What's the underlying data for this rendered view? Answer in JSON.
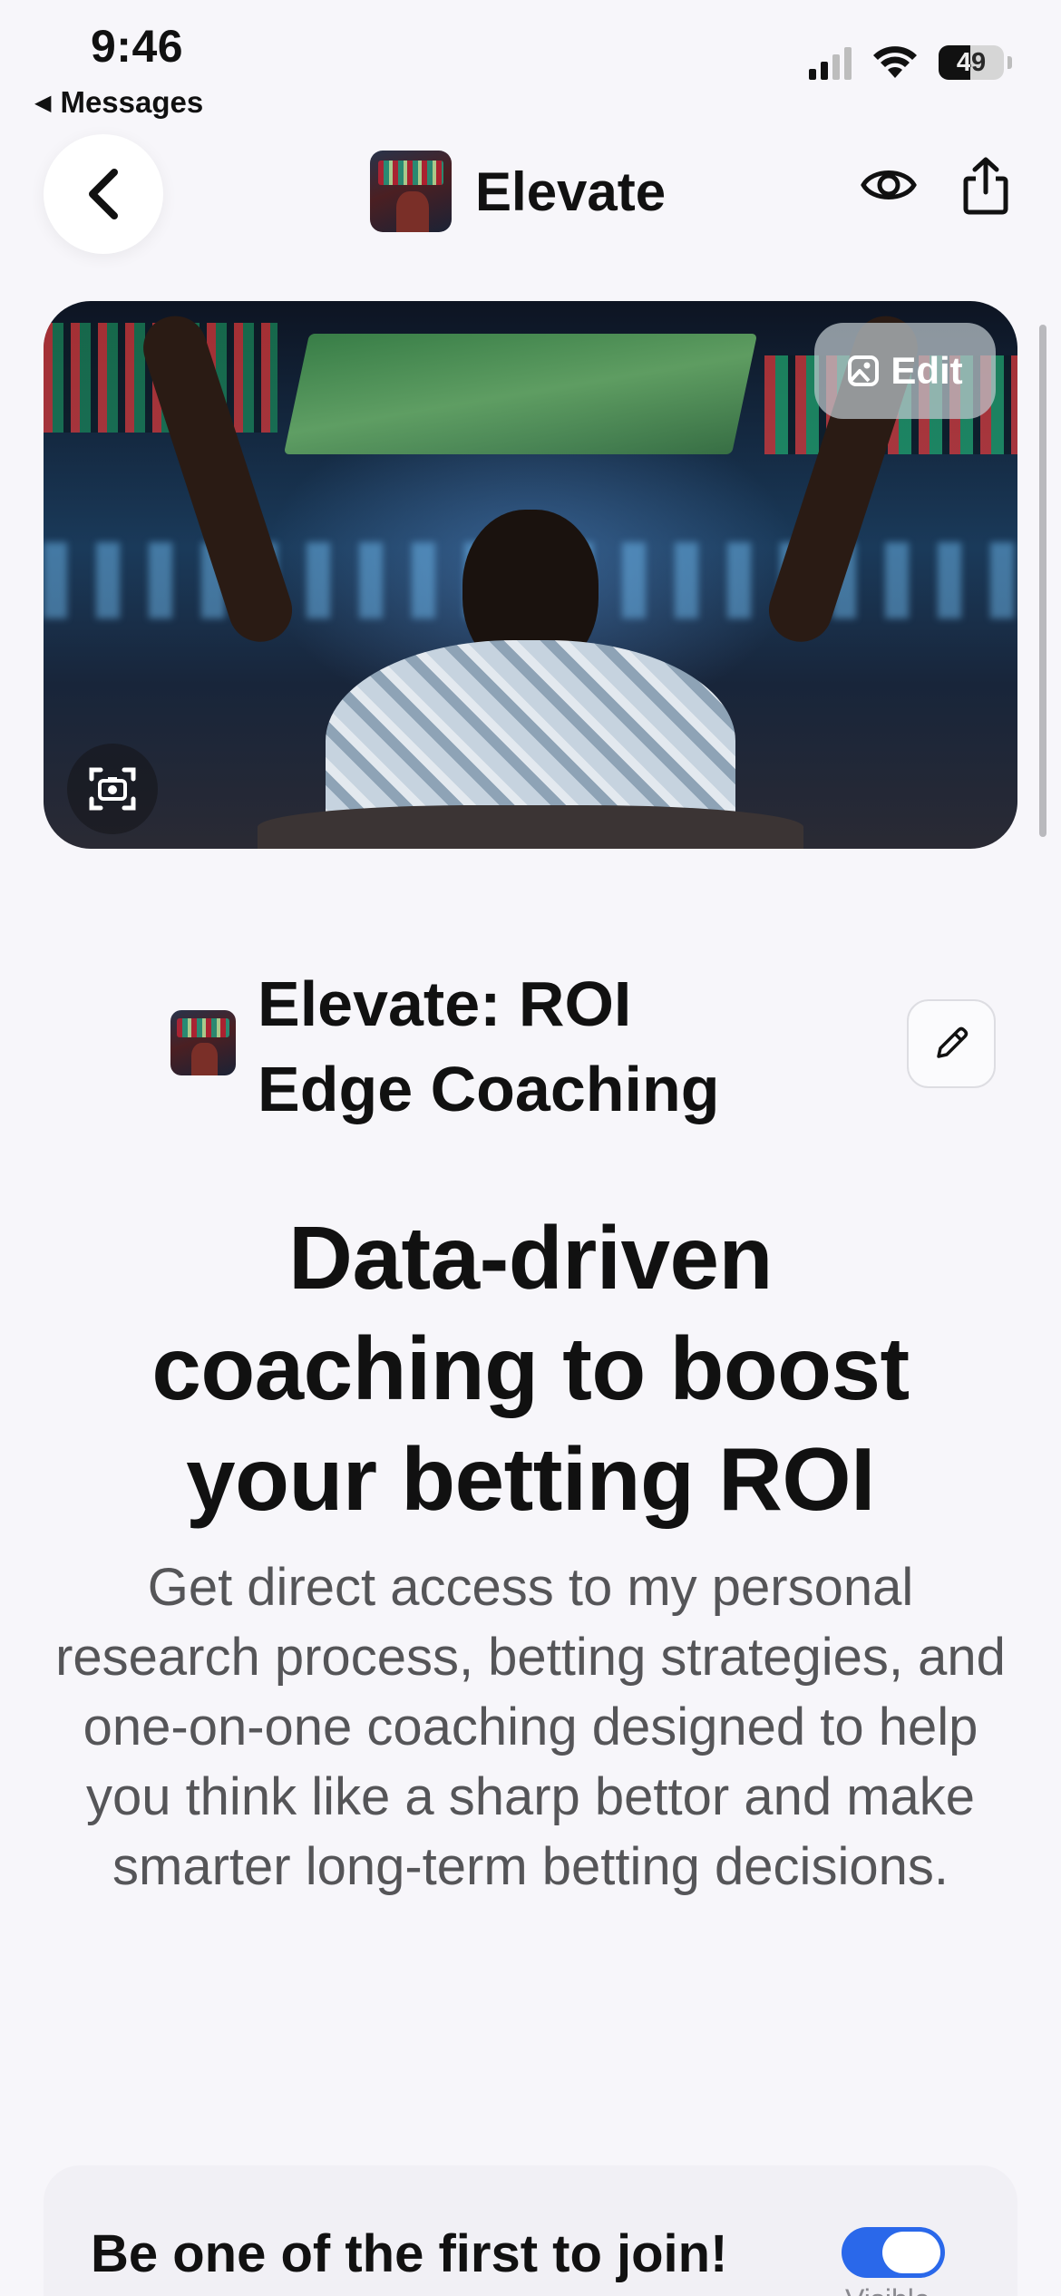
{
  "status_bar": {
    "time": "9:46",
    "back_app": "Messages",
    "battery": "49"
  },
  "nav": {
    "title": "Elevate",
    "icons": [
      "chevron-left-icon",
      "eye-icon",
      "share-icon"
    ]
  },
  "hero": {
    "edit_label": "Edit"
  },
  "product": {
    "title_line1": "Elevate: ROI",
    "title_line2": "Edge Coaching"
  },
  "headline": {
    "line1": "Data-driven",
    "line2": "coaching to boost",
    "line3": "your betting ROI"
  },
  "description": "Get direct access to my personal research process, betting strategies, and one-on-one coaching designed to help you think like a sharp bettor and make smarter long-term betting decisions.",
  "join": {
    "title": "Be one of the first to join!",
    "toggle_label": "Visible",
    "toggle_on": true
  },
  "colors": {
    "accent": "#2a68ea",
    "background": "#f7f6fa"
  }
}
